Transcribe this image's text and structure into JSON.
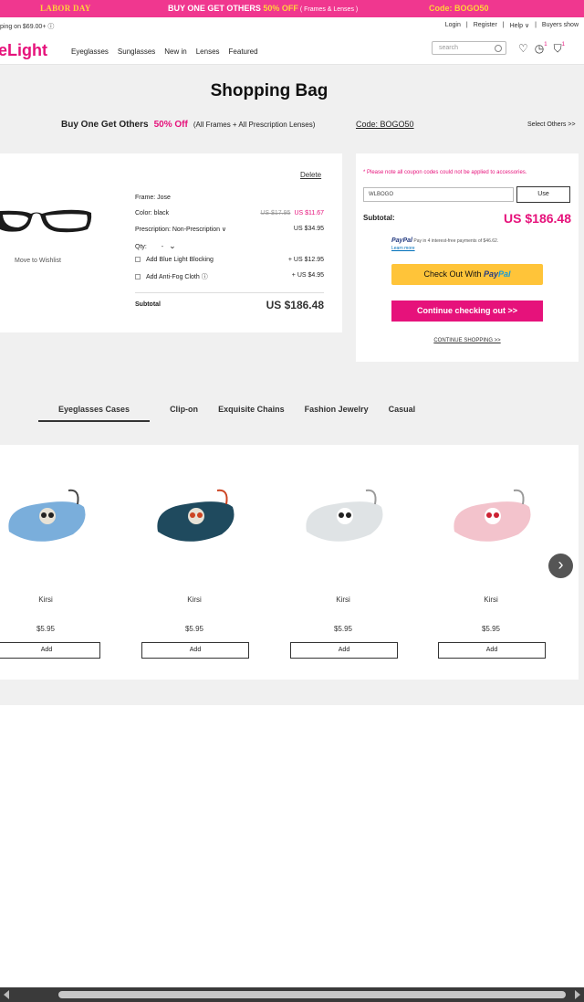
{
  "promo": {
    "left": "LABOR DAY",
    "middle_prefix": "BUY ONE GET OTHERS ",
    "middle_pct": "50% OFF",
    "middle_small": " ( Frames & Lenses )",
    "code": "Code: BOGO50"
  },
  "util": {
    "shipping": "ping on $69.00+ ⓘ",
    "login": "Login",
    "register": "Register",
    "help": "Help ∨",
    "buyers_show": "Buyers show"
  },
  "nav": {
    "logo": "eLight",
    "menu": [
      "Eyeglasses",
      "Sunglasses",
      "New in",
      "Lenses",
      "Featured"
    ],
    "search_placeholder": "search",
    "history_badge": "1",
    "cart_badge": "1"
  },
  "page": {
    "title": "Shopping Bag",
    "offer_text": "Buy One Get Others",
    "offer_pct": "50% Off",
    "offer_frames": "(All Frames + All Prescription Lenses)",
    "offer_code": "Code: BOGO50",
    "select_others": "Select Others >>"
  },
  "cart_item": {
    "delete": "Delete",
    "move_to_wishlist": "Move to Wishlist",
    "frame": "Frame: Jose",
    "color": "Color: black",
    "original_price": "US $17.95",
    "sale_price": "US $11.67",
    "prescription": "Prescription: Non-Prescription ∨",
    "prescription_price": "US $34.95",
    "qty_label": "Qty:",
    "qty_value": "-",
    "blue_light": "Add Blue Light Blocking",
    "blue_light_price": "+ US $12.95",
    "antifog": "Add Anti-Fog Cloth ⓘ",
    "antifog_price": "+ US $4.95",
    "subtotal_label": "Subtotal",
    "subtotal": "US $186.48"
  },
  "summary": {
    "note": "* Please note all coupon codes could not be applied to accessories.",
    "coupon_value": "WLBOGO",
    "use": "Use",
    "subtotal_label": "Subtotal:",
    "subtotal": "US $186.48",
    "paypal_brand": "PayPal",
    "paypal_text": " Pay in 4 interest-free payments of $46.62.",
    "learn_more": "Learn more",
    "checkout_prefix": "Check Out With ",
    "checkout_pay": "Pay",
    "checkout_pal": "Pal",
    "continue_checkout": "Continue checking out >>",
    "continue_shopping": "CONTINUE SHOPPING >>"
  },
  "tabs": [
    "Eyeglasses Cases",
    "Clip-on",
    "Exquisite Chains",
    "Fashion Jewelry",
    "Casual"
  ],
  "products": [
    {
      "name": "Kirsi",
      "price": "$5.95",
      "add": "Add",
      "color": "#7aaedb"
    },
    {
      "name": "Kirsi",
      "price": "$5.95",
      "add": "Add",
      "color": "#1f4a5e"
    },
    {
      "name": "Kirsi",
      "price": "$5.95",
      "add": "Add",
      "color": "#dfe3e5"
    },
    {
      "name": "Kirsi",
      "price": "$5.95",
      "add": "Add",
      "color": "#f3c3cc"
    }
  ]
}
